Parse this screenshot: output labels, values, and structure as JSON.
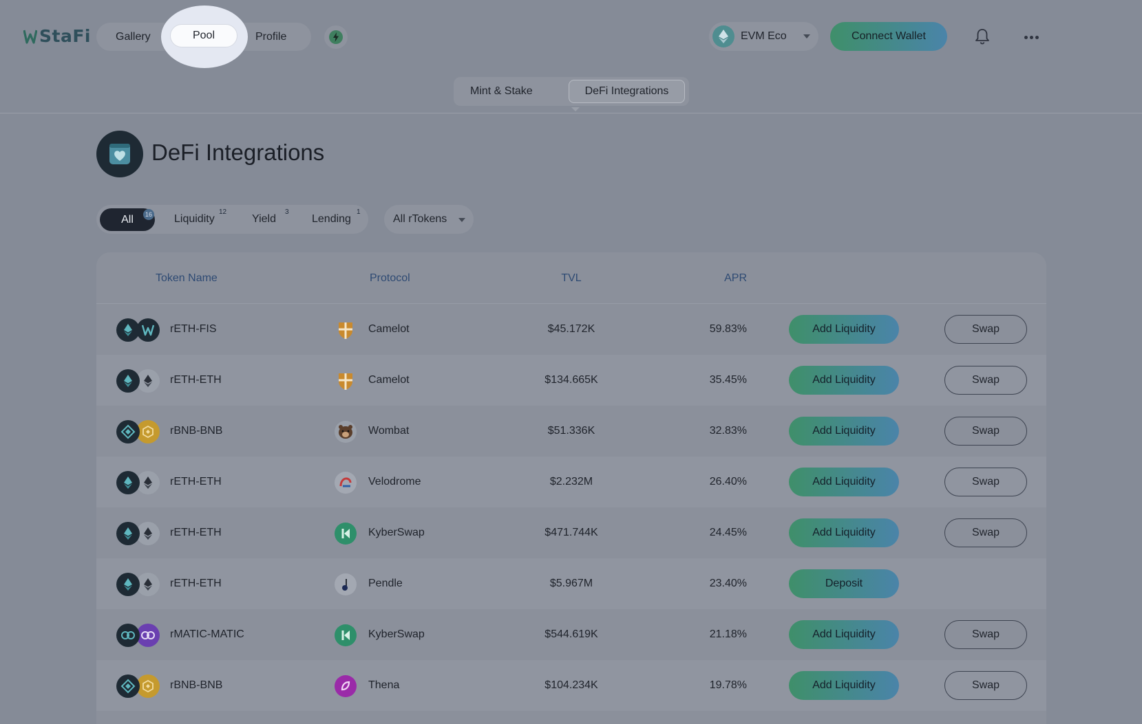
{
  "header": {
    "logo_text": "StaFi",
    "nav": {
      "gallery": "Gallery",
      "pool": "Pool",
      "profile": "Profile"
    },
    "eco_select": "EVM Eco",
    "connect_wallet": "Connect Wallet"
  },
  "subtabs": {
    "mint": "Mint & Stake",
    "defi": "DeFi Integrations"
  },
  "page_title": "DeFi Integrations",
  "filters": {
    "all": {
      "label": "All",
      "count": "16"
    },
    "liquidity": {
      "label": "Liquidity",
      "count": "12"
    },
    "yield": {
      "label": "Yield",
      "count": "3"
    },
    "lending": {
      "label": "Lending",
      "count": "1"
    },
    "rtokens": "All rTokens"
  },
  "table": {
    "headers": {
      "token": "Token Name",
      "protocol": "Protocol",
      "tvl": "TVL",
      "apr": "APR"
    },
    "rows": [
      {
        "token": "rETH-FIS",
        "protocol": "Camelot",
        "tvl": "$45.172K",
        "apr": "59.83%",
        "action": "Add Liquidity",
        "swap": "Swap"
      },
      {
        "token": "rETH-ETH",
        "protocol": "Camelot",
        "tvl": "$134.665K",
        "apr": "35.45%",
        "action": "Add Liquidity",
        "swap": "Swap"
      },
      {
        "token": "rBNB-BNB",
        "protocol": "Wombat",
        "tvl": "$51.336K",
        "apr": "32.83%",
        "action": "Add Liquidity",
        "swap": "Swap"
      },
      {
        "token": "rETH-ETH",
        "protocol": "Velodrome",
        "tvl": "$2.232M",
        "apr": "26.40%",
        "action": "Add Liquidity",
        "swap": "Swap"
      },
      {
        "token": "rETH-ETH",
        "protocol": "KyberSwap",
        "tvl": "$471.744K",
        "apr": "24.45%",
        "action": "Add Liquidity",
        "swap": "Swap"
      },
      {
        "token": "rETH-ETH",
        "protocol": "Pendle",
        "tvl": "$5.967M",
        "apr": "23.40%",
        "action": "Deposit"
      },
      {
        "token": "rMATIC-MATIC",
        "protocol": "KyberSwap",
        "tvl": "$544.619K",
        "apr": "21.18%",
        "action": "Add Liquidity",
        "swap": "Swap"
      },
      {
        "token": "rBNB-BNB",
        "protocol": "Thena",
        "tvl": "$104.234K",
        "apr": "19.78%",
        "action": "Add Liquidity",
        "swap": "Swap"
      }
    ]
  },
  "colors": {
    "background": "#858b97",
    "accent_gradient_start": "#3f8f6a",
    "accent_gradient_end": "#4a84a9",
    "header_text": "#2e4a73"
  },
  "icons": {
    "logo": "stafi-logo-icon",
    "bolt": "bolt-icon",
    "bell": "bell-icon",
    "more": "more-dots-icon",
    "title": "heart-card-icon"
  }
}
